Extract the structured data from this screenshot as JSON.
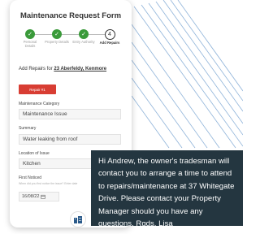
{
  "form": {
    "title": "Maintenance Request Form",
    "steps": [
      {
        "label": "Personal Details",
        "status": "complete",
        "marker": "✓"
      },
      {
        "label": "Property Details",
        "status": "complete",
        "marker": "✓"
      },
      {
        "label": "Entry Authority",
        "status": "complete",
        "marker": "✓"
      },
      {
        "label": "Add Repairs",
        "status": "current",
        "marker": "4"
      }
    ],
    "add_repairs_prefix": "Add Repairs for",
    "add_repairs_address": "23 Aberfeldy, Kenmore",
    "repair_button_label": "Repair #1",
    "category_label": "Maintenance Category",
    "category_value": "Maintenance Issue",
    "summary_label": "Summary",
    "summary_value": "Water leaking from roof",
    "location_label": "Location of Issue",
    "location_value": "Kitchen",
    "first_noticed_label": "First Noticed",
    "first_noticed_hint": "When did you first notice the issue? Enter date",
    "first_noticed_value": "16/08/22"
  },
  "message": {
    "text": "Hi Andrew, the owner's tradesman will contact you to arrange a time to attend to repairs/maintenance at 37 Whitegate Drive. Please contact your Property Manager should you have any questions. Rgds, Lisa"
  },
  "colors": {
    "accent_green": "#3a9a3a",
    "button_red": "#d83d33",
    "bubble_bg": "#243640",
    "diagonal_lines": "#8fb3d9"
  },
  "icons": {
    "message_avatar": "building-icon",
    "date_picker": "calendar-icon"
  }
}
